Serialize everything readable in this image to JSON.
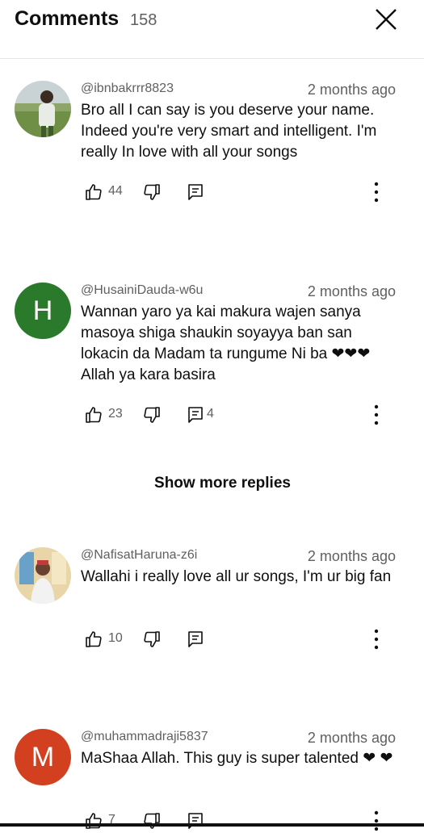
{
  "header": {
    "title": "Comments",
    "count": "158"
  },
  "comments": [
    {
      "author": "@ibnbakrrr8823",
      "time": "2 months ago",
      "text": "Bro all I can say is you deserve your name. Indeed you're very smart and intelligent. I'm really In love with all your songs",
      "likes": "44",
      "replies": "",
      "avatar": {
        "type": "photo",
        "colors": [
          "#c9d3d6",
          "#6f8f46",
          "#3e5a2c"
        ]
      }
    },
    {
      "author": "@HusainiDauda-w6u",
      "time": "2 months ago",
      "text": "Wannan yaro ya kai makura wajen sanya masoya shiga shaukin soyayya ban san lokacin da Madam ta rungume Ni ba ❤❤❤ Allah ya kara basira",
      "likes": "23",
      "replies": "4",
      "avatar": {
        "type": "letter",
        "letter": "H",
        "color": "#2b7a2b"
      }
    },
    {
      "author": "@NafisatHaruna-z6i",
      "time": "2 months ago",
      "text": "Wallahi i really love all ur songs, I'm ur big fan",
      "likes": "10",
      "replies": "",
      "avatar": {
        "type": "photo",
        "colors": [
          "#e8d6a8",
          "#6aa1c9",
          "#f2f2f2"
        ]
      }
    },
    {
      "author": "@muhammadraji5837",
      "time": "2 months ago",
      "text": "MaShaa Allah. This guy is super talented ❤ ❤",
      "likes": "7",
      "replies": "",
      "avatar": {
        "type": "letter",
        "letter": "M",
        "color": "#d3401f"
      }
    }
  ],
  "show_more_replies": "Show more replies"
}
